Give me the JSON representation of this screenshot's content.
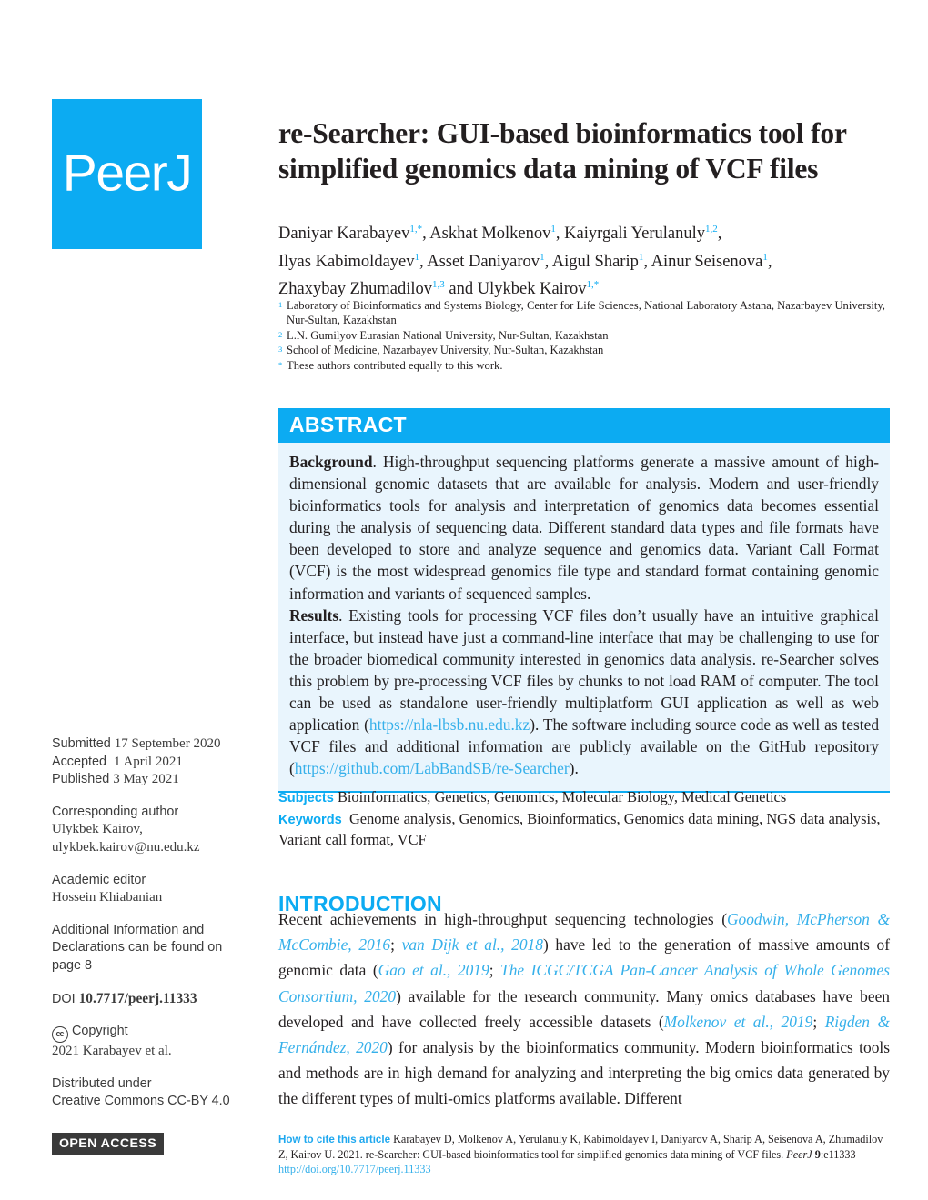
{
  "logo": {
    "brand_main": "Peer",
    "brand_j": "J",
    "color": "#0cabf2"
  },
  "article": {
    "title": "re-Searcher: GUI-based bioinformatics tool for simplified genomics data mining of VCF files",
    "authors_line_1_a": "Daniyar Karabayev",
    "authors_line_1_a_sup": "1,*",
    "authors_line_1_b": ",  Askhat Molkenov",
    "authors_line_1_b_sup": "1",
    "authors_line_1_c": ",  Kaiyrgali Yerulanuly",
    "authors_line_1_c_sup": "1,2",
    "authors_line_1_d": ",",
    "authors_line_2_a": "Ilyas Kabimoldayev",
    "authors_line_2_a_sup": "1",
    "authors_line_2_b": ",  Asset Daniyarov",
    "authors_line_2_b_sup": "1",
    "authors_line_2_c": ",  Aigul Sharip",
    "authors_line_2_c_sup": "1",
    "authors_line_2_d": ",  Ainur Seisenova",
    "authors_line_2_d_sup": "1",
    "authors_line_2_e": ",",
    "authors_line_3_a": "Zhaxybay Zhumadilov",
    "authors_line_3_a_sup": "1,3",
    "authors_line_3_b": " and  Ulykbek Kairov",
    "authors_line_3_b_sup": "1,*"
  },
  "affiliations": [
    {
      "marker": "1",
      "text": "Laboratory of Bioinformatics and Systems Biology, Center for Life Sciences, National Laboratory Astana, Nazarbayev University, Nur-Sultan, Kazakhstan"
    },
    {
      "marker": "2",
      "text": "L.N. Gumilyov Eurasian National University, Nur-Sultan, Kazakhstan"
    },
    {
      "marker": "3",
      "text": "School of Medicine, Nazarbayev University, Nur-Sultan, Kazakhstan"
    },
    {
      "marker": "*",
      "text": "These authors contributed equally to this work."
    }
  ],
  "abstract": {
    "heading": "ABSTRACT",
    "background_label": "Background",
    "background_text": ". High-throughput sequencing platforms generate a massive amount of high-dimensional genomic datasets that are available for analysis. Modern and user-friendly bioinformatics tools for analysis and interpretation of genomics data becomes essential during the analysis of sequencing data. Different standard data types and file formats have been developed to store and analyze sequence and genomics data. Variant Call Format (VCF) is the most widespread genomics file type and standard format containing genomic information and variants of sequenced samples.",
    "results_label": "Results",
    "results_text_1": ". Existing tools for processing VCF files don’t usually have an intuitive graphical interface, but instead have just a command-line interface that may be challenging to use for the broader biomedical community interested in genomics data analysis. re-Searcher solves this problem by pre-processing VCF files by chunks to not load RAM of computer. The tool can be used as standalone user-friendly multiplatform GUI application as well as web application (",
    "results_link_1": "https://nla-lbsb.nu.edu.kz",
    "results_text_2": "). The software including source code as well as tested VCF files and additional information are publicly available on the GitHub repository (",
    "results_link_2": "https://github.com/LabBandSB/re-Searcher",
    "results_text_3": ")."
  },
  "subjects": {
    "subjects_label": "Subjects",
    "subjects_text": "Bioinformatics, Genetics, Genomics, Molecular Biology, Medical Genetics",
    "keywords_label": "Keywords",
    "keywords_text": "Genome analysis, Genomics, Bioinformatics, Genomics data mining, NGS data analysis, Variant call format, VCF"
  },
  "introduction": {
    "heading": "INTRODUCTION",
    "t1": "Recent achievements in high-throughput sequencing technologies (",
    "c1": "Goodwin, McPherson & McCombie, 2016",
    "t2": "; ",
    "c2": "van Dijk et al., 2018",
    "t3": ") have led to the generation of massive amounts of genomic data (",
    "c3": "Gao et al., 2019",
    "t4": ";  ",
    "c4": "The ICGC/TCGA Pan-Cancer Analysis of Whole Genomes Consortium, 2020",
    "t5": ") available for the research community. Many omics databases have been developed and have collected freely accessible datasets (",
    "c5": "Molkenov et al., 2019",
    "t6": "; ",
    "c6": "Rigden & Fernández, 2020",
    "t7": ") for analysis by the bioinformatics community. Modern bioinformatics tools and methods are in high demand for analyzing and interpreting the big omics data generated by the different types of multi-omics platforms available. Different"
  },
  "meta": {
    "submitted_label": "Submitted",
    "submitted_value": "17 September 2020",
    "accepted_label": "Accepted",
    "accepted_value": "1 April 2021",
    "published_label": "Published",
    "published_value": "3 May 2021",
    "corresponding_label": "Corresponding author",
    "corresponding_name": "Ulykbek Kairov,",
    "corresponding_email": "ulykbek.kairov@nu.edu.kz",
    "editor_label": "Academic editor",
    "editor_name": "Hossein Khiabanian",
    "additional_info_line1": "Additional Information and",
    "additional_info_line2": "Declarations can be found on",
    "additional_info_line3": "page 8",
    "doi_label": "DOI",
    "doi_value": "10.7717/peerj.11333",
    "cc_icon_text": "cc",
    "copyright_label": "Copyright",
    "copyright_value": "2021 Karabayev et al.",
    "license_line1": "Distributed under",
    "license_line2": "Creative Commons CC-BY 4.0",
    "open_access_badge": "OPEN ACCESS"
  },
  "footer": {
    "howto_label": "How to cite this article",
    "citation_text": "Karabayev D, Molkenov A, Yerulanuly K, Kabimoldayev I, Daniyarov A, Sharip A, Seisenova A, Zhumadilov Z, Kairov U. 2021. re-Searcher: GUI-based bioinformatics tool for simplified genomics data mining of VCF files.",
    "journal": "PeerJ",
    "volume": "9",
    "article_no": ":e11333",
    "doi_url": "http://doi.org/10.7717/peerj.11333"
  }
}
